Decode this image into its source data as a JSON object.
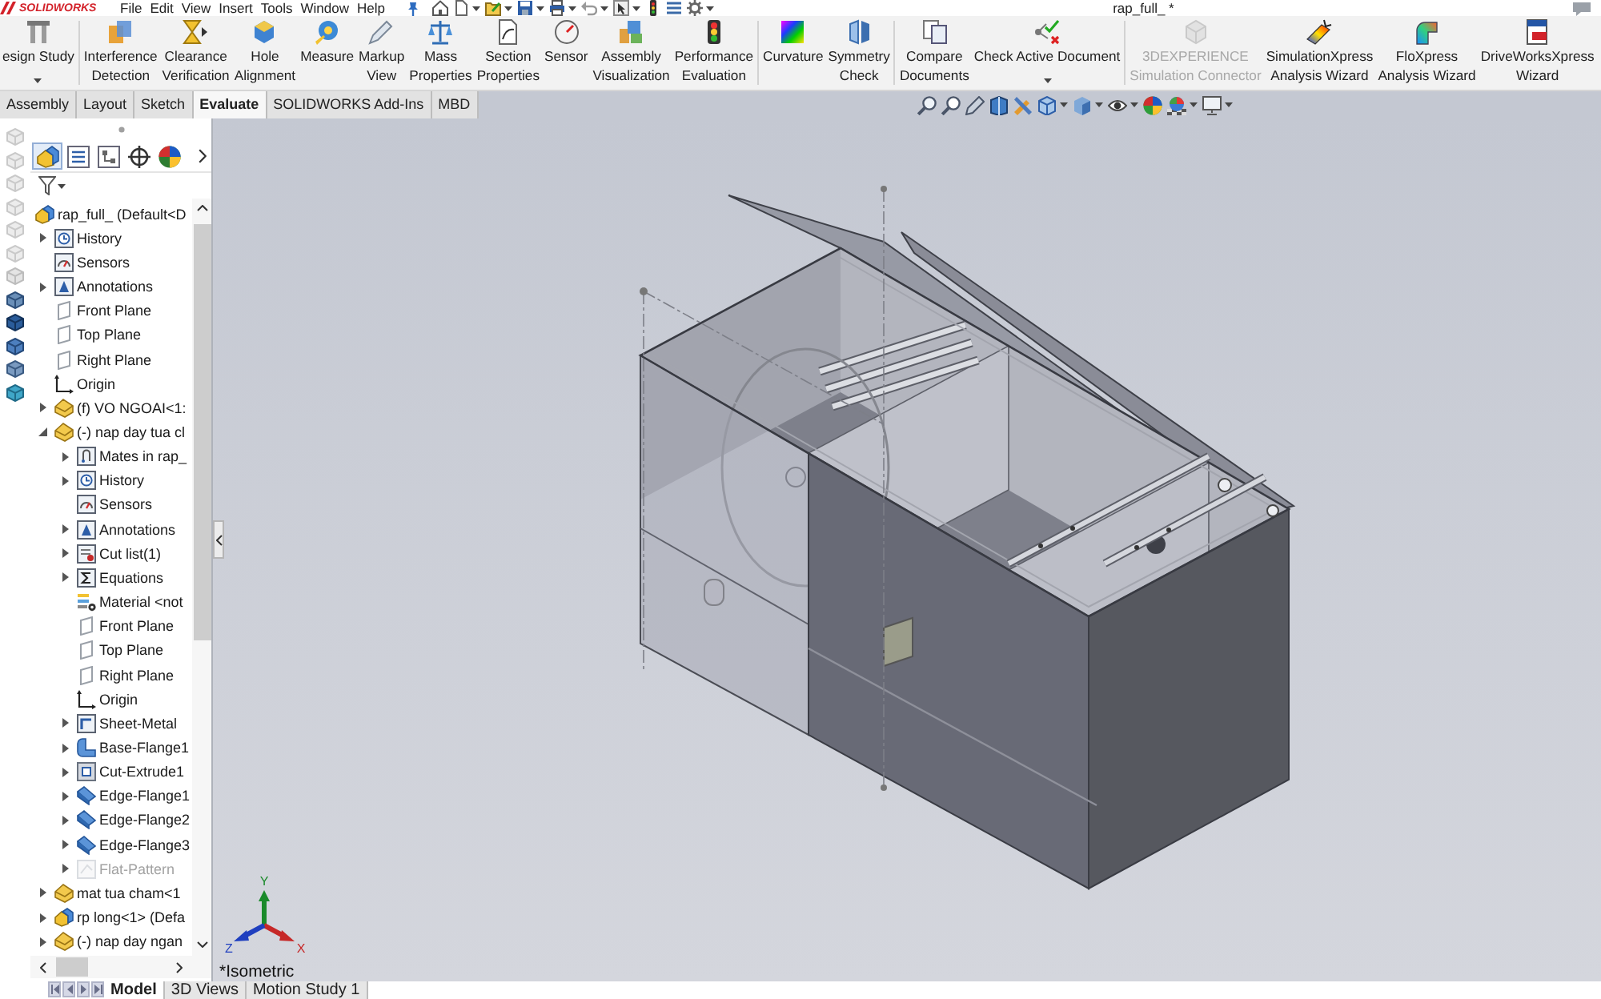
{
  "title_bar": {
    "logo": "SOLIDWORKS",
    "menu": [
      "File",
      "Edit",
      "View",
      "Insert",
      "Tools",
      "Window",
      "Help"
    ],
    "document_title": "rap_full_ *"
  },
  "ribbon": {
    "groups": [
      [
        {
          "label": "esign Study",
          "dropdown": true,
          "disabled": false
        }
      ],
      [
        {
          "label": "Interference\nDetection",
          "dropdown": false,
          "disabled": false
        },
        {
          "label": "Clearance\nVerification",
          "dropdown": false,
          "disabled": false
        },
        {
          "label": "Hole\nAlignment",
          "dropdown": false,
          "disabled": false
        },
        {
          "label": "Measure",
          "dropdown": false,
          "disabled": false
        },
        {
          "label": "Markup\nView",
          "dropdown": false,
          "disabled": false
        },
        {
          "label": "Mass\nProperties",
          "dropdown": false,
          "disabled": false
        },
        {
          "label": "Section\nProperties",
          "dropdown": false,
          "disabled": false
        },
        {
          "label": "Sensor",
          "dropdown": false,
          "disabled": false
        },
        {
          "label": "Assembly\nVisualization",
          "dropdown": false,
          "disabled": false
        },
        {
          "label": "Performance\nEvaluation",
          "dropdown": false,
          "disabled": false
        }
      ],
      [
        {
          "label": "Curvature",
          "dropdown": false,
          "disabled": false
        },
        {
          "label": "Symmetry\nCheck",
          "dropdown": false,
          "disabled": false
        }
      ],
      [
        {
          "label": "Compare\nDocuments",
          "dropdown": false,
          "disabled": false
        },
        {
          "label": "Check Active Document",
          "dropdown": true,
          "disabled": false
        }
      ],
      [
        {
          "label": "3DEXPERIENCE\nSimulation Connector",
          "dropdown": false,
          "disabled": true
        },
        {
          "label": "SimulationXpress\nAnalysis Wizard",
          "dropdown": false,
          "disabled": false
        },
        {
          "label": "FloXpress\nAnalysis Wizard",
          "dropdown": false,
          "disabled": false
        },
        {
          "label": "DriveWorksXpress\nWizard",
          "dropdown": false,
          "disabled": false
        }
      ]
    ]
  },
  "command_tabs": [
    {
      "label": "Assembly",
      "selected": false
    },
    {
      "label": "Layout",
      "selected": false
    },
    {
      "label": "Sketch",
      "selected": false
    },
    {
      "label": "Evaluate",
      "selected": true
    },
    {
      "label": "SOLIDWORKS Add-Ins",
      "selected": false
    },
    {
      "label": "MBD",
      "selected": false
    }
  ],
  "feature_manager": {
    "panel_tabs": [
      {
        "selected": true
      },
      {
        "selected": false
      },
      {
        "selected": false
      },
      {
        "selected": false
      },
      {
        "selected": false
      }
    ],
    "tree": {
      "label": "rap_full_ (Default<D",
      "kind": "assembly",
      "children": [
        {
          "label": "History",
          "kind": "history",
          "expandable": true,
          "expanded": false,
          "disabled": false
        },
        {
          "label": "Sensors",
          "kind": "sensors",
          "expandable": false,
          "expanded": false,
          "disabled": false
        },
        {
          "label": "Annotations",
          "kind": "annotations",
          "expandable": true,
          "expanded": false,
          "disabled": false
        },
        {
          "label": "Front Plane",
          "kind": "plane",
          "expandable": false,
          "expanded": false,
          "disabled": false
        },
        {
          "label": "Top Plane",
          "kind": "plane",
          "expandable": false,
          "expanded": false,
          "disabled": false
        },
        {
          "label": "Right Plane",
          "kind": "plane",
          "expandable": false,
          "expanded": false,
          "disabled": false
        },
        {
          "label": "Origin",
          "kind": "origin",
          "expandable": false,
          "expanded": false,
          "disabled": false
        },
        {
          "label": "(f) VO NGOAI<1:",
          "kind": "part",
          "expandable": true,
          "expanded": false,
          "disabled": false
        },
        {
          "label": "(-) nap day tua cl",
          "kind": "part",
          "expandable": true,
          "expanded": true,
          "disabled": false,
          "children": [
            {
              "label": "Mates in rap_",
              "kind": "mates",
              "expandable": true,
              "expanded": false,
              "disabled": false
            },
            {
              "label": "History",
              "kind": "history",
              "expandable": true,
              "expanded": false,
              "disabled": false
            },
            {
              "label": "Sensors",
              "kind": "sensors",
              "expandable": false,
              "expanded": false,
              "disabled": false
            },
            {
              "label": "Annotations",
              "kind": "annotations",
              "expandable": true,
              "expanded": false,
              "disabled": false
            },
            {
              "label": "Cut list(1)",
              "kind": "cut_list",
              "expandable": true,
              "expanded": false,
              "disabled": false
            },
            {
              "label": "Equations",
              "kind": "equations",
              "expandable": true,
              "expanded": false,
              "disabled": false
            },
            {
              "label": "Material <not",
              "kind": "material",
              "expandable": false,
              "expanded": false,
              "disabled": false
            },
            {
              "label": "Front Plane",
              "kind": "plane",
              "expandable": false,
              "expanded": false,
              "disabled": false
            },
            {
              "label": "Top Plane",
              "kind": "plane",
              "expandable": false,
              "expanded": false,
              "disabled": false
            },
            {
              "label": "Right Plane",
              "kind": "plane",
              "expandable": false,
              "expanded": false,
              "disabled": false
            },
            {
              "label": "Origin",
              "kind": "origin",
              "expandable": false,
              "expanded": false,
              "disabled": false
            },
            {
              "label": "Sheet-Metal",
              "kind": "sheet_metal",
              "expandable": true,
              "expanded": false,
              "disabled": false
            },
            {
              "label": "Base-Flange1",
              "kind": "base_flange",
              "expandable": true,
              "expanded": false,
              "disabled": false
            },
            {
              "label": "Cut-Extrude1",
              "kind": "cut_extrude",
              "expandable": true,
              "expanded": false,
              "disabled": false
            },
            {
              "label": "Edge-Flange1",
              "kind": "edge_flange",
              "expandable": true,
              "expanded": false,
              "disabled": false
            },
            {
              "label": "Edge-Flange2",
              "kind": "edge_flange",
              "expandable": true,
              "expanded": false,
              "disabled": false
            },
            {
              "label": "Edge-Flange3",
              "kind": "edge_flange",
              "expandable": true,
              "expanded": false,
              "disabled": false
            },
            {
              "label": "Flat-Pattern",
              "kind": "flat_pattern",
              "expandable": true,
              "expanded": false,
              "disabled": true
            }
          ]
        },
        {
          "label": "mat tua cham<1",
          "kind": "part",
          "expandable": true,
          "expanded": false,
          "disabled": false
        },
        {
          "label": "rp long<1> (Defa",
          "kind": "assembly",
          "expandable": true,
          "expanded": false,
          "disabled": false
        },
        {
          "label": "(-) nap day ngan",
          "kind": "part",
          "expandable": true,
          "expanded": false,
          "disabled": false
        }
      ]
    }
  },
  "viewport": {
    "view_name": "*Isometric",
    "triad": {
      "y": "Y",
      "x": "X",
      "z": "Z"
    }
  },
  "bottom_tabs": [
    {
      "label": "Model",
      "selected": true
    },
    {
      "label": "3D Views",
      "selected": false
    },
    {
      "label": "Motion Study 1",
      "selected": false
    }
  ]
}
